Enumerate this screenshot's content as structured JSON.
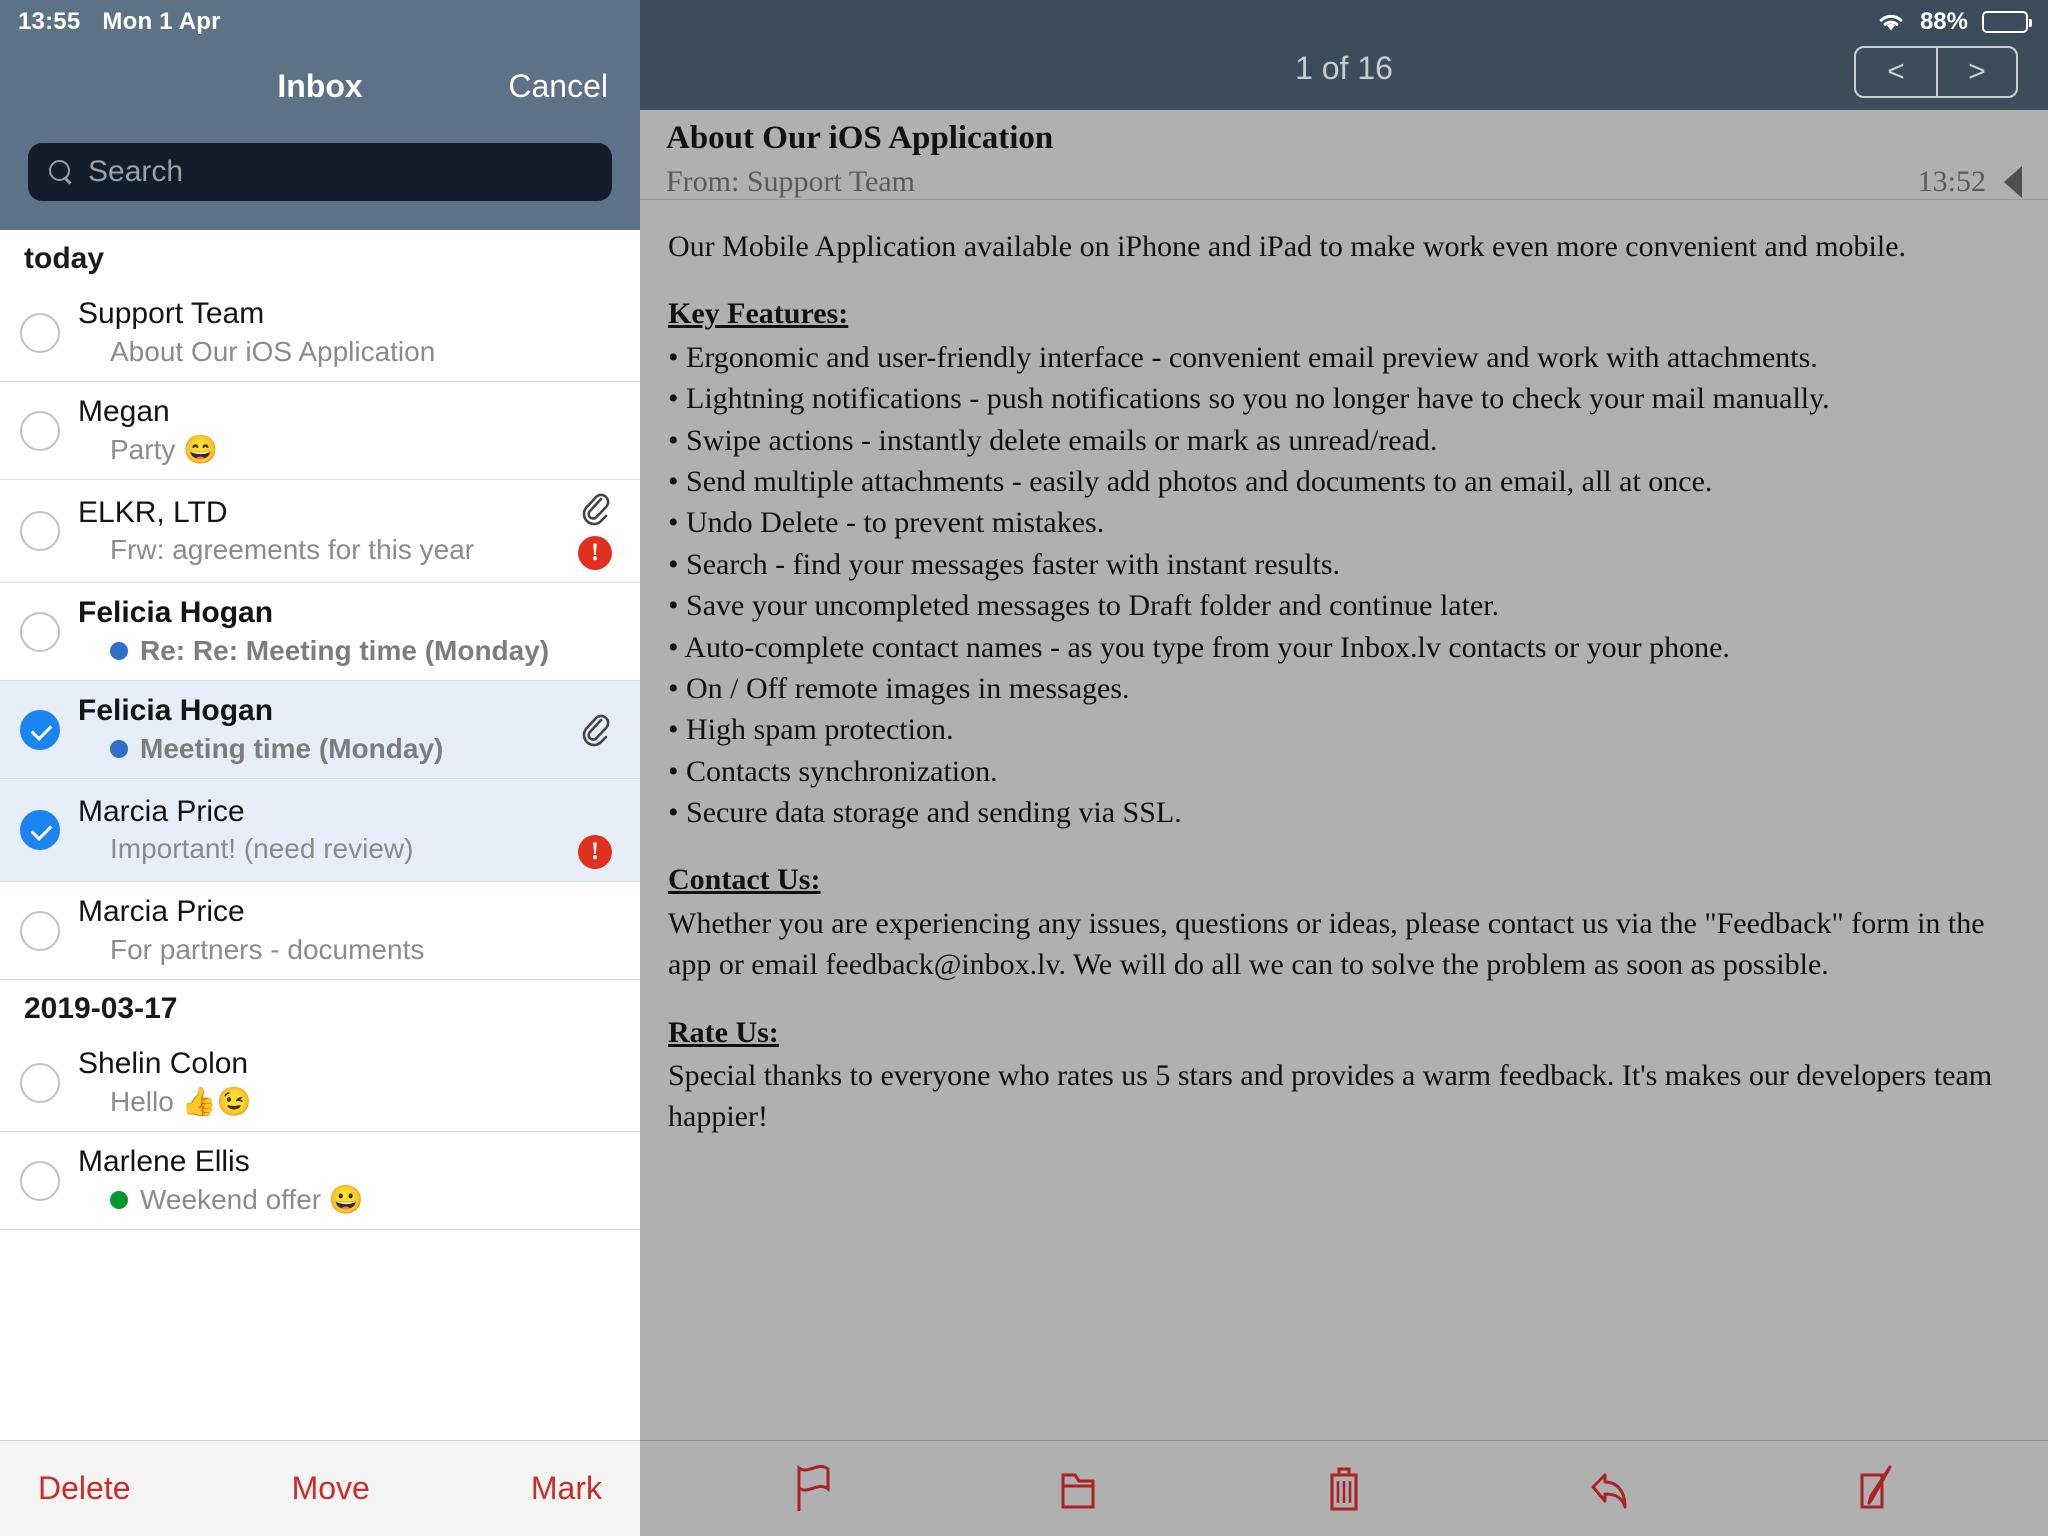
{
  "status_bar": {
    "time": "13:55",
    "date": "Mon 1 Apr",
    "battery_percent": "88%",
    "wifi_icon": "wifi-icon",
    "battery_icon": "battery-icon"
  },
  "sidebar": {
    "title": "Inbox",
    "cancel_label": "Cancel",
    "search": {
      "placeholder": "Search",
      "value": "",
      "icon": "search-icon"
    },
    "groups": [
      {
        "header": "today",
        "messages": [
          {
            "sender": "Support Team",
            "subject": "About Our iOS Application",
            "selected": false,
            "unread": false,
            "bold": false,
            "attachment": false,
            "important": false,
            "dot_color": ""
          },
          {
            "sender": "Megan",
            "subject": "Party 😄",
            "selected": false,
            "unread": false,
            "bold": false,
            "attachment": false,
            "important": false,
            "dot_color": ""
          },
          {
            "sender": "ELKR, LTD",
            "subject": "Frw: agreements for this year",
            "selected": false,
            "unread": false,
            "bold": false,
            "attachment": true,
            "important": true,
            "dot_color": ""
          },
          {
            "sender": "Felicia Hogan",
            "subject": "Re: Re: Meeting time (Monday)",
            "selected": false,
            "unread": true,
            "bold": true,
            "attachment": false,
            "important": false,
            "dot_color": "#2e70c8"
          },
          {
            "sender": "Felicia Hogan",
            "subject": "Meeting time (Monday)",
            "selected": true,
            "unread": true,
            "bold": true,
            "attachment": true,
            "important": false,
            "dot_color": "#2e70c8"
          },
          {
            "sender": "Marcia Price",
            "subject": "Important! (need review)",
            "selected": true,
            "unread": false,
            "bold": false,
            "attachment": false,
            "important": true,
            "dot_color": ""
          },
          {
            "sender": "Marcia Price",
            "subject": "For partners - documents",
            "selected": false,
            "unread": false,
            "bold": false,
            "attachment": false,
            "important": false,
            "dot_color": ""
          }
        ]
      },
      {
        "header": "2019-03-17",
        "messages": [
          {
            "sender": "Shelin Colon",
            "subject": "Hello 👍😉",
            "selected": false,
            "unread": false,
            "bold": false,
            "attachment": false,
            "important": false,
            "dot_color": ""
          },
          {
            "sender": "Marlene    Ellis",
            "subject": "Weekend offer 😀",
            "selected": false,
            "unread": true,
            "bold": false,
            "attachment": false,
            "important": false,
            "dot_color": "#009a2e"
          }
        ]
      }
    ],
    "toolbar": {
      "delete_label": "Delete",
      "move_label": "Move",
      "mark_label": "Mark"
    }
  },
  "detail": {
    "counter": "1 of 16",
    "pager": {
      "prev_label": "<",
      "next_label": ">"
    },
    "mail": {
      "subject": "About Our iOS Application",
      "from": "From: Support Team",
      "time": "13:52",
      "collapse_icon": "triangle-left-icon",
      "intro": "Our Mobile Application available on iPhone and iPad to make work even more convenient and mobile.",
      "features_title": "Key Features:",
      "features": [
        "Ergonomic and user-friendly interface - convenient email preview and work with attachments.",
        "Lightning notifications - push notifications so you no longer have to check your mail manually.",
        "Swipe actions - instantly delete emails or mark as unread/read.",
        "Send multiple attachments - easily add photos and documents to an email, all at once.",
        "Undo Delete - to prevent mistakes.",
        "Search - find your messages faster with instant results.",
        "Save your uncompleted messages to Draft folder and continue later.",
        "Auto-complete contact names - as you type from your Inbox.lv contacts or your phone.",
        "On / Off remote images in messages.",
        "High spam protection.",
        "Contacts synchronization.",
        "Secure data storage and sending via SSL."
      ],
      "contact_title": "Contact Us: ",
      "contact_body": "Whether you are experiencing any issues, questions or ideas, please contact us via the \"Feedback\" form in the app or email feedback@inbox.lv. We will do all we can to solve the problem as soon as possible.",
      "rate_title": "Rate Us:",
      "rate_body": "Special thanks to everyone who rates us 5 stars and provides a warm feedback. It's makes our developers team happier!"
    },
    "toolbar_icons": [
      "flag-icon",
      "folder-icon",
      "trash-icon",
      "reply-icon",
      "compose-icon"
    ]
  },
  "colors": {
    "nav_bar": "#3c4c5a",
    "sidebar_nav": "#5d7287",
    "detail_bg": "#b0b0b0",
    "selection": "#e7eefa",
    "checkbox_on": "#1a84f0",
    "toolbar_red": "#cc2b26",
    "important_red": "#e0301e",
    "unread_blue": "#2e70c8",
    "unread_green": "#009a2e"
  }
}
